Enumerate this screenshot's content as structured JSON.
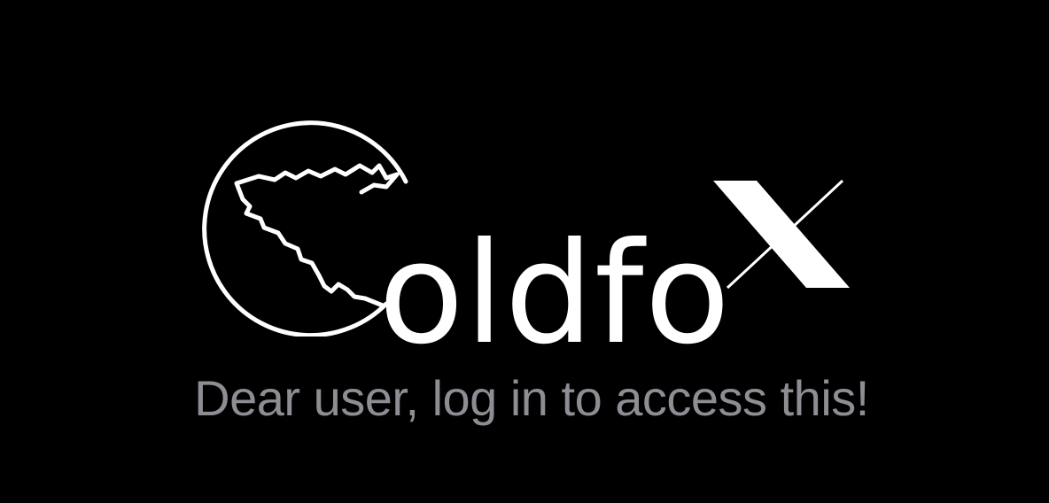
{
  "logo": {
    "name": "Oldfox",
    "wordmark": "oldfo",
    "icon": "fox-head-in-circle-icon",
    "accent_letter": "X"
  },
  "message": {
    "text": "Dear user, log in to access this!"
  },
  "colors": {
    "background": "#000000",
    "logo": "#ffffff",
    "message": "#8d8d93"
  }
}
